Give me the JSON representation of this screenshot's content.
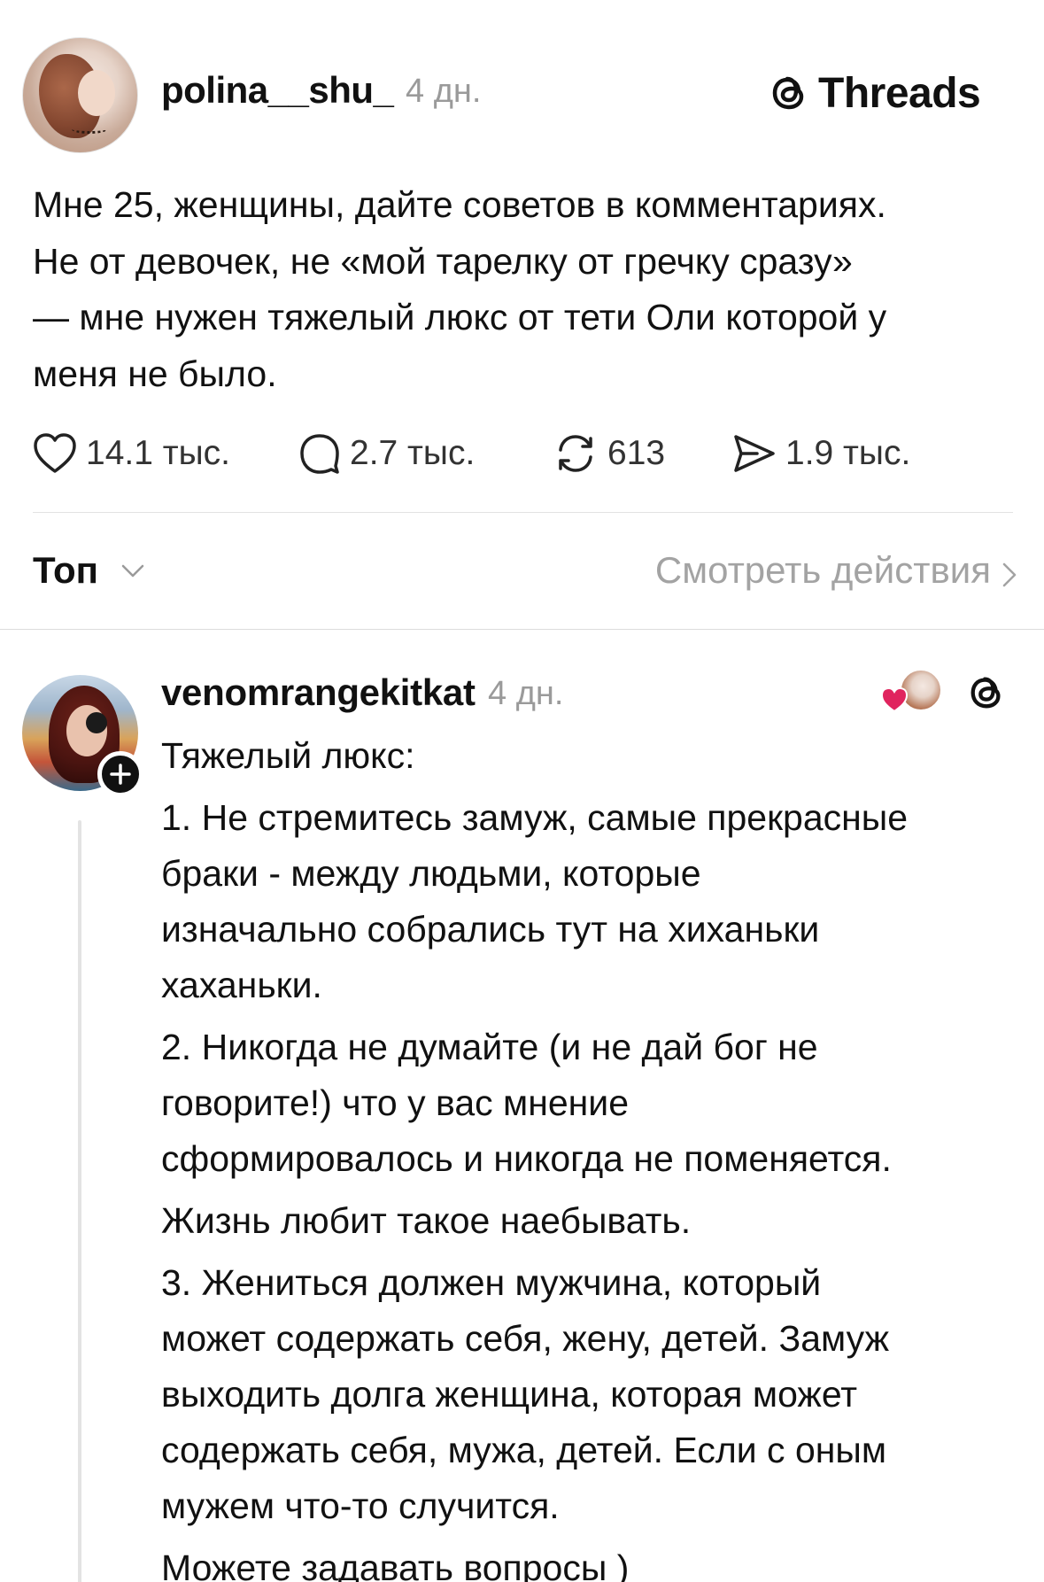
{
  "post": {
    "username": "polina__shu_",
    "time": "4 дн.",
    "brand": "Threads",
    "text_lines": [
      "Мне 25, женщины, дайте советов в комментариях.",
      "Не от девочек, не «мой тарелку от гречку сразу»",
      "— мне нужен тяжелый люкс от тети Оли которой у",
      "меня не было."
    ],
    "actions": {
      "likes": "14.1 тыс.",
      "replies": "2.7 тыс.",
      "reposts": "613",
      "shares": "1.9 тыс."
    }
  },
  "sort": {
    "label": "Топ",
    "view_activity": "Смотреть действия"
  },
  "reply": {
    "username": "venomrangekitkat",
    "time": "4 дн.",
    "paragraphs": [
      [
        "Тяжелый люкс:"
      ],
      [
        "1. Не стремитесь замуж, самые прекрасные",
        "браки - между людьми, которые",
        "изначально собрались тут на хиханьки",
        "хаханьки."
      ],
      [
        "2. Никогда не думайте (и не дай бог не",
        "говорите!) что у вас мнение",
        "сформировалось и никогда не поменяется."
      ],
      [
        "Жизнь любит такое наебывать."
      ],
      [
        "3. Жениться должен мужчина, который",
        "может содержать себя, жену, детей. Замуж",
        "выходить долга женщина, которая может",
        "содержать себя, мужа, детей. Если с оным",
        "мужем что-то случится."
      ],
      [
        "Можете задавать вопросы )"
      ]
    ]
  },
  "colors": {
    "text": "#111111",
    "muted": "#9a9a9a",
    "divider": "#e2e2e2",
    "heart": "#e0245e"
  },
  "icons": [
    "heart-icon",
    "comment-icon",
    "repost-icon",
    "share-icon",
    "threads-logo-icon",
    "chevron-down-icon",
    "chevron-right-icon",
    "plus-icon"
  ]
}
